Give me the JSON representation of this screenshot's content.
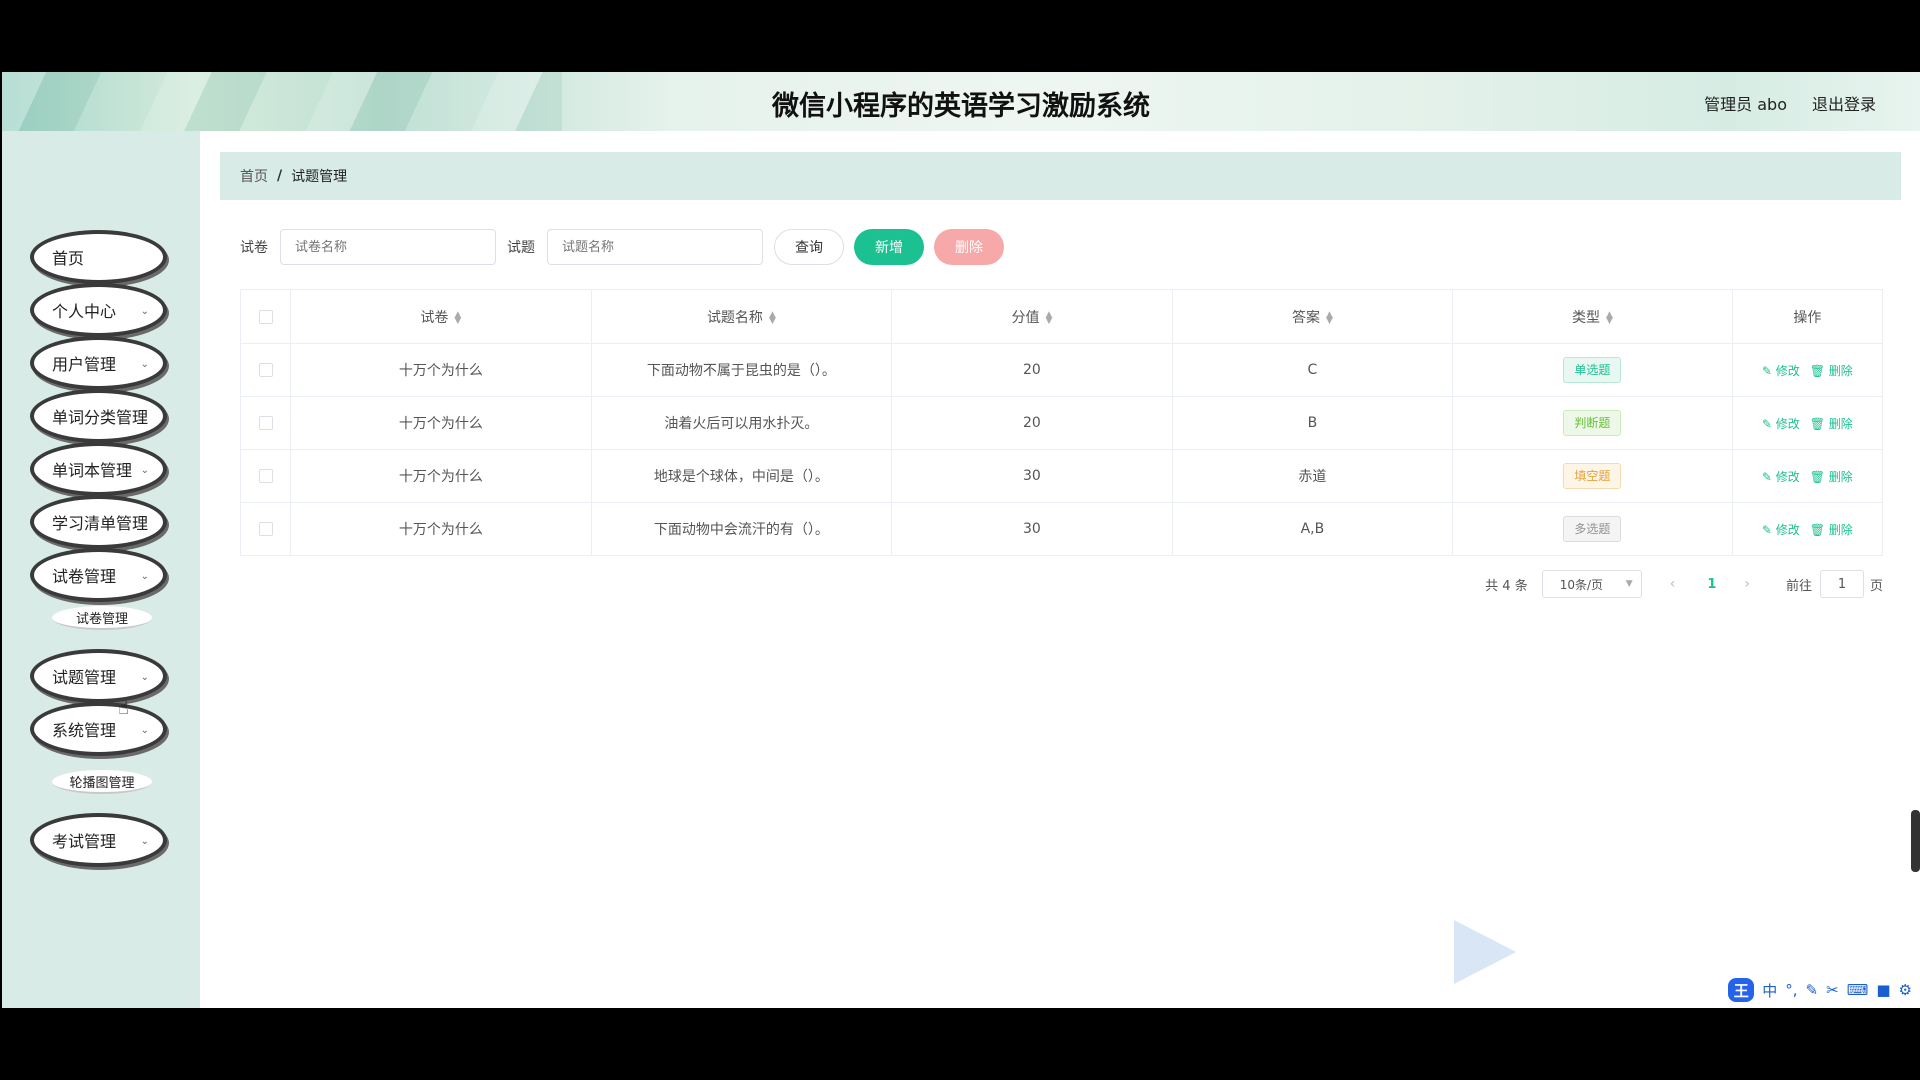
{
  "header": {
    "title": "微信小程序的英语学习激励系统",
    "user": "管理员 abo",
    "logout": "退出登录"
  },
  "sidebar": {
    "items": [
      {
        "label": "首页",
        "has_sub": false
      },
      {
        "label": "个人中心",
        "has_sub": true
      },
      {
        "label": "用户管理",
        "has_sub": true
      },
      {
        "label": "单词分类管理",
        "has_sub": false
      },
      {
        "label": "单词本管理",
        "has_sub": true
      },
      {
        "label": "学习清单管理",
        "has_sub": false
      },
      {
        "label": "试卷管理",
        "has_sub": true
      },
      {
        "label": "试题管理",
        "has_sub": true
      },
      {
        "label": "系统管理",
        "has_sub": true
      },
      {
        "label": "考试管理",
        "has_sub": true
      }
    ],
    "sub_exam_paper": "试卷管理",
    "sub_carousel": "轮播图管理"
  },
  "breadcrumb": {
    "home": "首页",
    "sep": "/",
    "current": "试题管理"
  },
  "search": {
    "paper_label": "试卷",
    "paper_placeholder": "试卷名称",
    "question_label": "试题",
    "question_placeholder": "试题名称",
    "query_button": "查询",
    "add_button": "新增",
    "delete_button": "删除"
  },
  "table": {
    "headers": {
      "paper": "试卷",
      "question": "试题名称",
      "score": "分值",
      "answer": "答案",
      "type": "类型",
      "actions": "操作"
    },
    "rows": [
      {
        "paper": "十万个为什么",
        "question": "下面动物不属于昆虫的是（）。",
        "score": "20",
        "answer": "C",
        "type": "单选题"
      },
      {
        "paper": "十万个为什么",
        "question": "油着火后可以用水扑灭。",
        "score": "20",
        "answer": "B",
        "type": "判断题"
      },
      {
        "paper": "十万个为什么",
        "question": "地球是个球体，中间是（）。",
        "score": "30",
        "answer": "赤道",
        "type": "填空题"
      },
      {
        "paper": "十万个为什么",
        "question": "下面动物中会流汗的有（）。",
        "score": "30",
        "answer": "A,B",
        "type": "多选题"
      }
    ],
    "edit_label": "修改",
    "delete_label": "删除"
  },
  "pagination": {
    "total": "共 4 条",
    "page_size": "10条/页",
    "current_page": "1",
    "goto_label": "前往",
    "goto_value": "1",
    "page_suffix": "页"
  },
  "ime": {
    "logo": "王",
    "mode": "中",
    "icons": [
      "dot-icon",
      "pen-icon",
      "scissors-icon",
      "keyboard-icon",
      "shirt-icon",
      "gear-icon"
    ]
  }
}
